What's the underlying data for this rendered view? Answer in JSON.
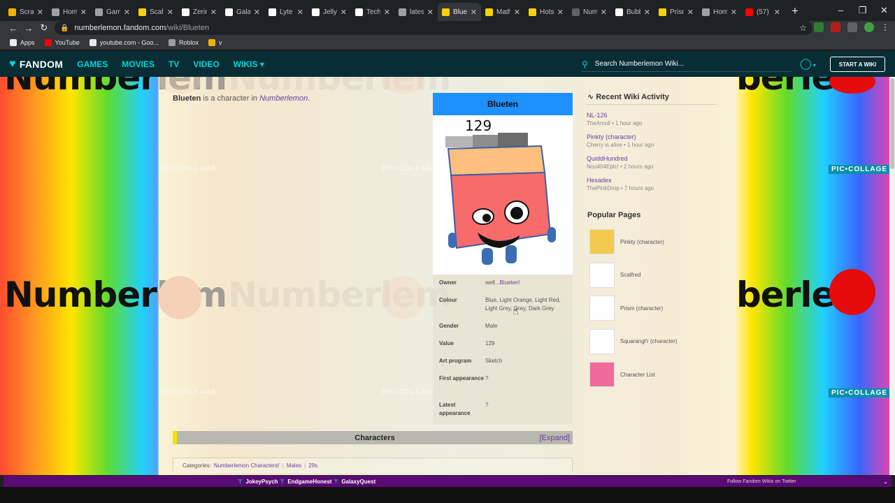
{
  "browser": {
    "tabs": [
      {
        "label": "Scrat",
        "color": "#f0b400",
        "active": false
      },
      {
        "label": "Hom",
        "color": "#9aa0a6",
        "active": false
      },
      {
        "label": "Game",
        "color": "#9aa0a6",
        "active": false
      },
      {
        "label": "Scalf",
        "color": "#f6d200",
        "active": false
      },
      {
        "label": "Zerin",
        "color": "#ffffff",
        "active": false
      },
      {
        "label": "Gala",
        "color": "#ffffff",
        "active": false
      },
      {
        "label": "Lyte",
        "color": "#ffffff",
        "active": false
      },
      {
        "label": "Jelly",
        "color": "#ffffff",
        "active": false
      },
      {
        "label": "Tech",
        "color": "#ffffff",
        "active": false
      },
      {
        "label": "lates",
        "color": "#9aa0a6",
        "active": false
      },
      {
        "label": "Bluet",
        "color": "#f6d200",
        "active": true
      },
      {
        "label": "Math",
        "color": "#f6d200",
        "active": false
      },
      {
        "label": "Hots",
        "color": "#f6d200",
        "active": false
      },
      {
        "label": "Num",
        "color": "#5f6368",
        "active": false
      },
      {
        "label": "Bubb",
        "color": "#ffffff",
        "active": false
      },
      {
        "label": "Prism",
        "color": "#f6d200",
        "active": false
      },
      {
        "label": "Hom",
        "color": "#9aa0a6",
        "active": false
      },
      {
        "label": "(57)",
        "color": "#ff0000",
        "active": false
      }
    ],
    "new_tab": "+",
    "window_controls": [
      "–",
      "❐",
      "✕"
    ],
    "nav": {
      "back": "←",
      "forward": "→",
      "reload": "↻"
    },
    "url_host": "numberlemon.fandom.com",
    "url_path": "/wiki/Blueten",
    "star": "☆",
    "menu": "⋮",
    "bookmarks": [
      {
        "label": "Apps",
        "icon_color": "#e8eaed"
      },
      {
        "label": "YouTube",
        "icon_color": "#ff0000"
      },
      {
        "label": "youtube.com - Goo...",
        "icon_color": "#e8eaed"
      },
      {
        "label": "Roblox",
        "icon_color": "#9aa0a6"
      },
      {
        "label": "v",
        "icon_color": "#f0b400"
      }
    ]
  },
  "fandom": {
    "logo": "FANDOM",
    "nav": [
      "GAMES",
      "MOVIES",
      "TV",
      "VIDEO",
      "WIKIS"
    ],
    "wikis_caret": "▾",
    "search_placeholder": "Search Numberlemon Wiki...",
    "start_wiki": "START A WIKI",
    "accent": "#00d6d6",
    "header_bg": "#082d35"
  },
  "background": {
    "big_word": "Numberlem",
    "big_word_right": "berlem",
    "watermark": "PIC•COLLAGE"
  },
  "article": {
    "intro_bold": "Blueten",
    "intro_mid": " is a character in ",
    "intro_link": "Numberlemon",
    "intro_end": ".",
    "infobox": {
      "title": "Blueten",
      "image_number": "129",
      "rows": [
        {
          "key": "Owner",
          "value": "well...",
          "link": "Blueten!"
        },
        {
          "key": "Colour",
          "value": "Blue, Light Orange, Light Red, Light Grey, Grey, Dark Grey",
          "link": ""
        },
        {
          "key": "Gender",
          "value": "Male",
          "link": ""
        },
        {
          "key": "Value",
          "value": "129",
          "link": ""
        },
        {
          "key": "Art program",
          "value": "Sketch",
          "link": ""
        },
        {
          "key": "First appearance",
          "value": "?",
          "link": ""
        },
        {
          "key": "Latest appearance",
          "value": "?",
          "link": ""
        }
      ]
    },
    "characters_bar": {
      "title": "Characters",
      "expand": "[Expand]"
    },
    "categories": {
      "label": "Categories:",
      "items": [
        "Numberlemon Characters!",
        "Males",
        "29s"
      ]
    }
  },
  "rail": {
    "activity_title": "Recent Wiki Activity",
    "activity": [
      {
        "name": "NL-126",
        "meta": "TheAmoll • 1 hour ago"
      },
      {
        "name": "Pinkty (character)",
        "meta": "Cherry is alive • 1 hour ago"
      },
      {
        "name": "QuiddHundred",
        "meta": "Nou404Epic! • 2 hours ago"
      },
      {
        "name": "Hexadex",
        "meta": "ThePinkDrop • 7 hours ago"
      }
    ],
    "popular_title": "Popular Pages",
    "popular": [
      {
        "label": "Pinkty (character)"
      },
      {
        "label": "Scalfred"
      },
      {
        "label": "Prism (character)"
      },
      {
        "label": "Squarangl'r (character)"
      },
      {
        "label": "Character List"
      }
    ]
  },
  "footer": {
    "items": [
      "JokeyPsych",
      "EndgameHonest",
      "GalaxyQuest"
    ],
    "follow": "Follow Fandom Wikis on Twitter",
    "caret": "⌄"
  }
}
